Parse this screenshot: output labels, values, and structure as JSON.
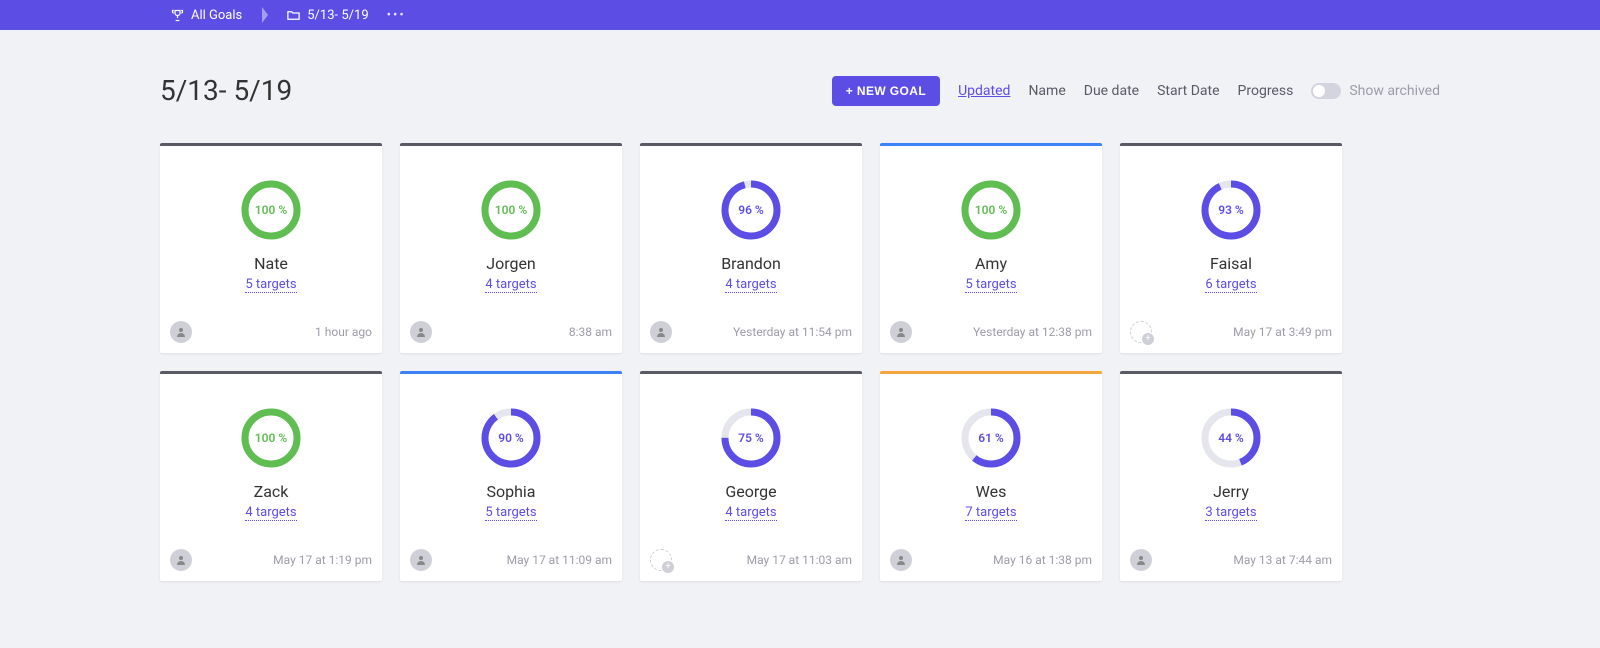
{
  "topbar": {
    "all_goals": "All Goals",
    "folder_label": "5/13- 5/19"
  },
  "header": {
    "title": "5/13- 5/19",
    "new_goal_label": "+ NEW GOAL",
    "sort_options": [
      "Updated",
      "Name",
      "Due date",
      "Start Date",
      "Progress"
    ],
    "active_sort_index": 0,
    "show_archived_label": "Show archived",
    "show_archived": false
  },
  "colors": {
    "accent": "#5c4de5",
    "green": "#5fbd52",
    "orange": "#f2a63c",
    "blue": "#3b82f6",
    "gray": "#5a5a66",
    "track": "#e5e5ed"
  },
  "cards": [
    {
      "name": "Nate",
      "percent": 100,
      "ring_color": "#5fbd52",
      "top_color": "#5a5a66",
      "targets_text": "5 targets",
      "timestamp": "1 hour ago",
      "avatar_empty": false
    },
    {
      "name": "Jorgen",
      "percent": 100,
      "ring_color": "#5fbd52",
      "top_color": "#5a5a66",
      "targets_text": "4 targets",
      "timestamp": "8:38 am",
      "avatar_empty": false
    },
    {
      "name": "Brandon",
      "percent": 96,
      "ring_color": "#5c4de5",
      "top_color": "#5a5a66",
      "targets_text": "4 targets",
      "timestamp": "Yesterday at 11:54 pm",
      "avatar_empty": false
    },
    {
      "name": "Amy",
      "percent": 100,
      "ring_color": "#5fbd52",
      "top_color": "#3b82f6",
      "targets_text": "5 targets",
      "timestamp": "Yesterday at 12:38 pm",
      "avatar_empty": false
    },
    {
      "name": "Faisal",
      "percent": 93,
      "ring_color": "#5c4de5",
      "top_color": "#5a5a66",
      "targets_text": "6 targets",
      "timestamp": "May 17 at 3:49 pm",
      "avatar_empty": true
    },
    {
      "name": "Zack",
      "percent": 100,
      "ring_color": "#5fbd52",
      "top_color": "#5a5a66",
      "targets_text": "4 targets",
      "timestamp": "May 17 at 1:19 pm",
      "avatar_empty": false
    },
    {
      "name": "Sophia",
      "percent": 90,
      "ring_color": "#5c4de5",
      "top_color": "#3b82f6",
      "targets_text": "5 targets",
      "timestamp": "May 17 at 11:09 am",
      "avatar_empty": false
    },
    {
      "name": "George",
      "percent": 75,
      "ring_color": "#5c4de5",
      "top_color": "#5a5a66",
      "targets_text": "4 targets",
      "timestamp": "May 17 at 11:03 am",
      "avatar_empty": true
    },
    {
      "name": "Wes",
      "percent": 61,
      "ring_color": "#5c4de5",
      "top_color": "#f2a63c",
      "targets_text": "7 targets",
      "timestamp": "May 16 at 1:38 pm",
      "avatar_empty": false
    },
    {
      "name": "Jerry",
      "percent": 44,
      "ring_color": "#5c4de5",
      "top_color": "#5a5a66",
      "targets_text": "3 targets",
      "timestamp": "May 13 at 7:44 am",
      "avatar_empty": false
    }
  ]
}
